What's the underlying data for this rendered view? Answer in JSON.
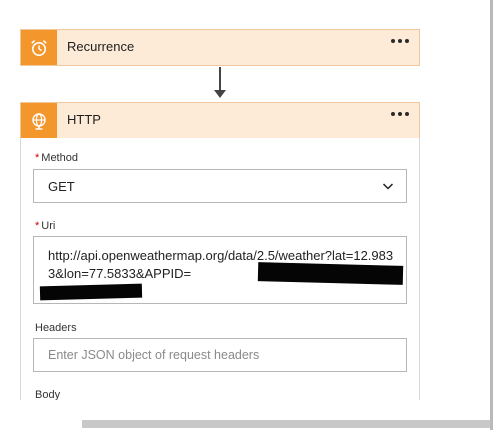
{
  "recurrence": {
    "title": "Recurrence",
    "icon": "alarm-clock-icon",
    "menu_icon": "more-options-icon"
  },
  "http": {
    "title": "HTTP",
    "icon": "globe-icon",
    "menu_icon": "more-options-icon",
    "method": {
      "label": "Method",
      "required_mark": "*",
      "value": "GET"
    },
    "uri": {
      "label": "Uri",
      "required_mark": "*",
      "value": "http://api.openweathermap.org/data/2.5/weather?lat=12.9833&lon=77.5833&APPID="
    },
    "headers": {
      "label": "Headers",
      "placeholder": "Enter JSON object of request headers"
    },
    "body": {
      "label": "Body"
    }
  },
  "colors": {
    "card_header_bg": "#fdebd8",
    "card_icon_bg": "#f3962c",
    "required": "#d00000"
  }
}
